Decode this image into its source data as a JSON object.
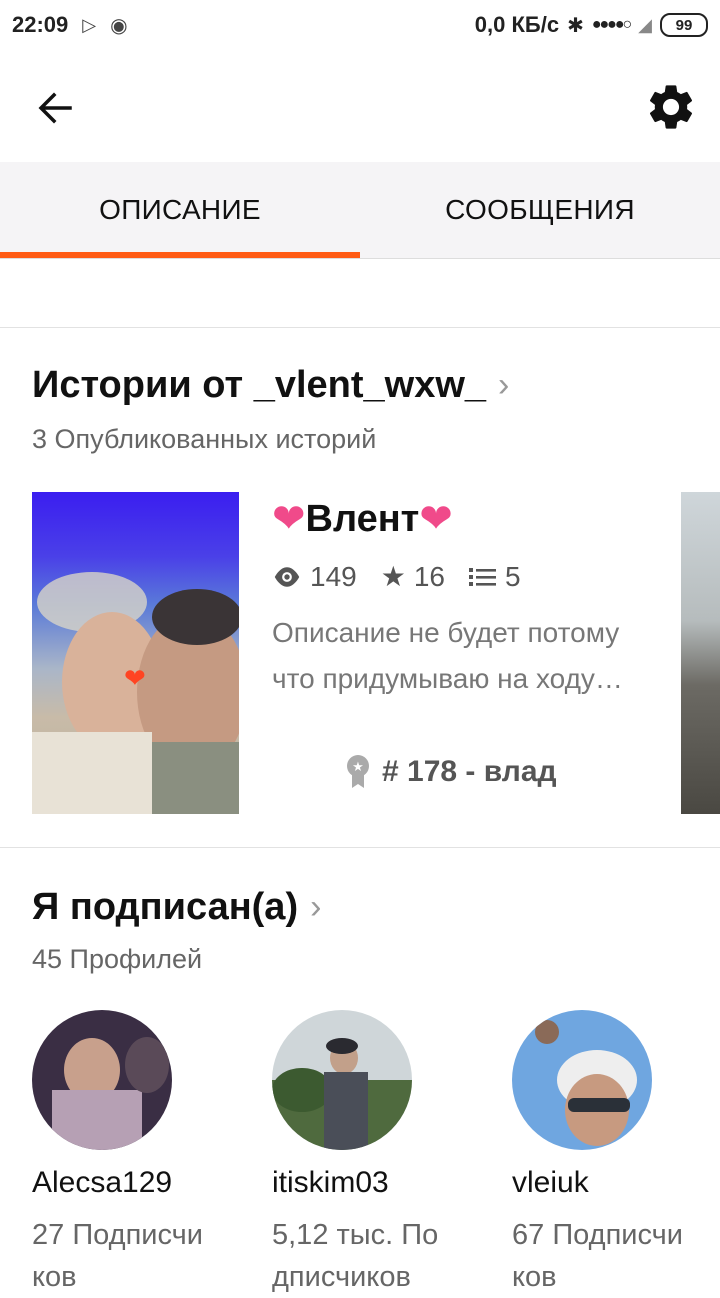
{
  "status_bar": {
    "time": "22:09",
    "network_speed": "0,0 КБ/с",
    "battery": "99"
  },
  "tabs": [
    {
      "label": "ОПИСАНИЕ",
      "active": true
    },
    {
      "label": "СООБЩЕНИЯ",
      "active": false
    }
  ],
  "stories_section": {
    "title": "Истории от _vlent_wxw_",
    "subtitle": "3 Опубликованных историй",
    "story": {
      "title": "Влент",
      "views": "149",
      "stars": "16",
      "parts": "5",
      "description": "Описание не будет потому что придумываю на ходу…",
      "rank": "# 178 - влад"
    }
  },
  "following_section": {
    "title": "Я подписан(а)",
    "subtitle": "45 Профилей",
    "profiles": [
      {
        "name": "Alecsa129",
        "followers": "27 Подписчи ков"
      },
      {
        "name": "itiskim03",
        "followers": "5,12 тыс. По дписчиков"
      },
      {
        "name": "vleiuk",
        "followers": "67 Подписчи ков"
      }
    ]
  },
  "colors": {
    "accent": "#ff5b14",
    "heart": "#f04a8a"
  }
}
